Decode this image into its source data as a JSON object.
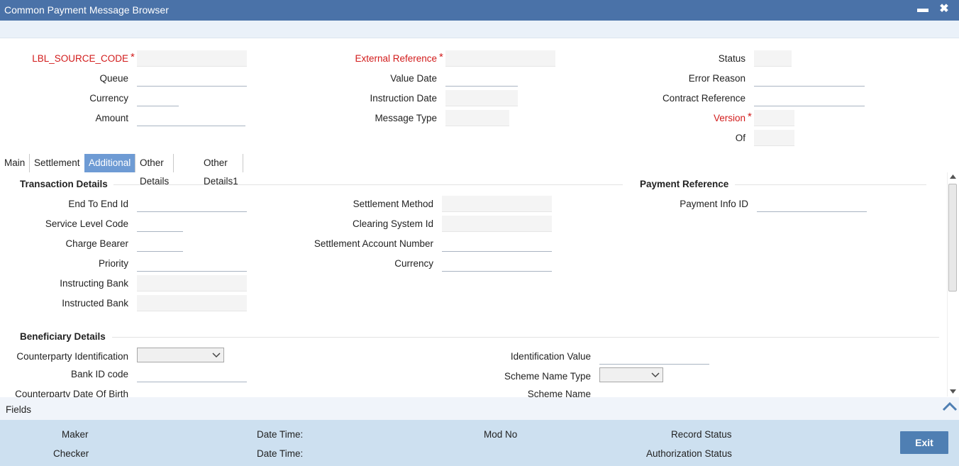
{
  "window": {
    "title": "Common Payment Message Browser",
    "minimize": "▬",
    "close": "✖"
  },
  "header": {
    "source_code_label": "LBL_SOURCE_CODE",
    "queue_label": "Queue",
    "currency_label": "Currency",
    "amount_label": "Amount",
    "external_reference_label": "External Reference",
    "value_date_label": "Value Date",
    "instruction_date_label": "Instruction Date",
    "message_type_label": "Message Type",
    "status_label": "Status",
    "error_reason_label": "Error Reason",
    "contract_reference_label": "Contract Reference",
    "version_label": "Version",
    "of_label": "Of",
    "required_marker": "*"
  },
  "tabs": [
    "Main",
    "Settlement",
    "Additional",
    "Other Details",
    "Other Details1"
  ],
  "active_tab": "Additional",
  "transaction": {
    "title": "Transaction Details",
    "end_to_end_label": "End To End Id",
    "service_level_label": "Service Level Code",
    "charge_bearer_label": "Charge Bearer",
    "priority_label": "Priority",
    "instructing_bank_label": "Instructing Bank",
    "instructed_bank_label": "Instructed Bank",
    "settlement_method_label": "Settlement Method",
    "clearing_system_label": "Clearing System Id",
    "settlement_account_label": "Settlement Account Number",
    "currency_label": "Currency"
  },
  "payment_reference": {
    "title": "Payment Reference",
    "payment_info_label": "Payment Info ID"
  },
  "beneficiary": {
    "title": "Beneficiary Details",
    "counterparty_identification_label": "Counterparty Identification",
    "bank_id_label": "Bank ID code",
    "counterparty_dob_label": "Counterparty Date Of Birth",
    "identification_value_label": "Identification Value",
    "scheme_name_type_label": "Scheme Name Type",
    "scheme_name_label": "Scheme Name"
  },
  "fields_bar": {
    "label": "Fields"
  },
  "footer": {
    "maker": "Maker",
    "checker": "Checker",
    "date_time_1": "Date Time:",
    "date_time_2": "Date Time:",
    "mod_no": "Mod No",
    "record_status": "Record Status",
    "authorization_status": "Authorization Status",
    "exit_label": "Exit"
  },
  "colors": {
    "titlebar": "#4a72a8",
    "active_tab": "#6e9bd4",
    "footer": "#cde0f0",
    "required": "#d21b1b"
  }
}
